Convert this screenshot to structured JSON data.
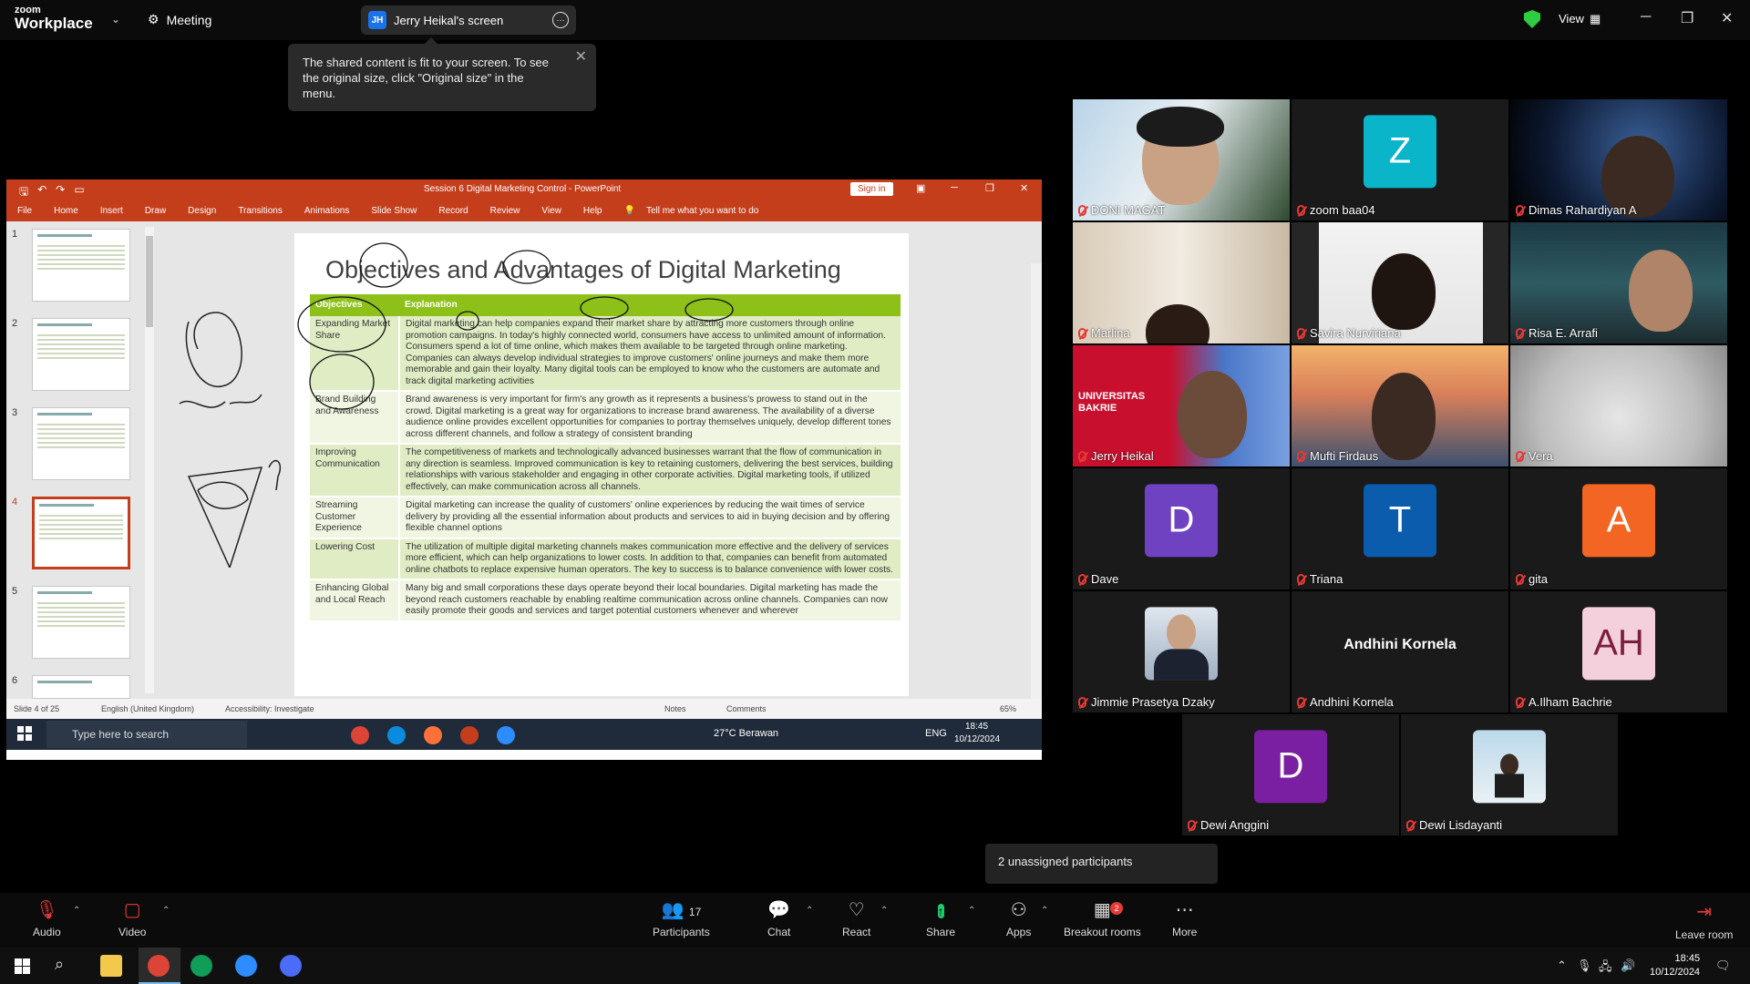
{
  "topbar": {
    "logo_line1": "zoom",
    "logo_line2": "Workplace",
    "meeting_label": "Meeting",
    "screen_badge": "JH",
    "screen_label": "Jerry Heikal's screen",
    "view_label": "View"
  },
  "tooltip": {
    "text": "The shared content is fit to your screen. To see the original size, click \"Original size\" in the menu."
  },
  "powerpoint": {
    "title": "Session 6 Digital Marketing Control  -  PowerPoint",
    "sign_in": "Sign in",
    "menu": [
      "File",
      "Home",
      "Insert",
      "Draw",
      "Design",
      "Transitions",
      "Animations",
      "Slide Show",
      "Record",
      "Review",
      "View",
      "Help"
    ],
    "tell_me": "Tell me what you want to do",
    "thumb_numbers": [
      "1",
      "2",
      "3",
      "4",
      "5",
      "6"
    ],
    "slide": {
      "title": "Objectives and Advantages of Digital Marketing",
      "col1": "Objectives",
      "col2": "Explanation",
      "rows": [
        {
          "objective": "Expanding Market Share",
          "explanation": "Digital marketing can help companies expand their market share by attracting more customers through online promotion campaigns. In today's highly connected world, consumers have access to unlimited amount of information. Consumers spend a lot of time online, which makes them available to be targeted through online marketing. Companies can always develop individual strategies to improve customers' online journeys and make them more memorable and gain their loyalty. Many digital tools can be employed to know who the customers are automate and track digital marketing activities"
        },
        {
          "objective": "Brand Building and Awareness",
          "explanation": "Brand awareness is very important for firm's any growth as it represents a business's prowess to stand out in the crowd. Digital marketing is a great way for organizations to increase brand awareness. The availability of a diverse audience online provides excellent opportunities for companies to portray themselves uniquely, develop different tones across different channels, and follow a strategy of consistent branding"
        },
        {
          "objective": "Improving Communication",
          "explanation": "The competitiveness of markets and technologically advanced businesses warrant that the flow of communication in any direction is seamless. Improved communication is key to retaining customers, delivering the best services, building relationships with various stakeholder and engaging in other corporate activities. Digital marketing tools, if utilized effectively, can make communication across all channels."
        },
        {
          "objective": "Streaming Customer Experience",
          "explanation": "Digital marketing can increase the quality of customers' online experiences by reducing the wait times of service delivery by providing all the essential information about products and services to aid in buying decision and by offering flexible channel options"
        },
        {
          "objective": "Lowering Cost",
          "explanation": "The utilization of multiple digital marketing channels makes communication more effective and the delivery of services more efficient, which can help organizations to lower costs. In addition to that, companies can benefit from automated online chatbots to replace expensive human operators. The key to success is to balance convenience with lower costs."
        },
        {
          "objective": "Enhancing Global and Local Reach",
          "explanation": "Many big and small corporations these days operate beyond their local boundaries. Digital marketing has made the beyond reach customers reachable by enabling realtime communication across online channels. Companies can now easily promote their goods and services and target potential customers whenever and wherever"
        }
      ]
    },
    "status": {
      "slide_of": "Slide 4 of 25",
      "language": "English (United Kingdom)",
      "accessibility": "Accessibility: Investigate",
      "notes": "Notes",
      "comments": "Comments",
      "zoom": "65%"
    },
    "inner_taskbar": {
      "search_placeholder": "Type here to search",
      "weather": "27°C  Berawan",
      "lang": "ENG",
      "time": "18:45",
      "date": "10/12/2024"
    }
  },
  "participants": [
    {
      "name": "DONI MAGAT"
    },
    {
      "name": "zoom baa04",
      "initial": "Z",
      "color": "#0bb5c9"
    },
    {
      "name": "Dimas Rahardiyan A"
    },
    {
      "name": "Marlina"
    },
    {
      "name": "Savira Nurviriana"
    },
    {
      "name": "Risa E. Arrafi"
    },
    {
      "name": "Jerry Heikal",
      "banner": "UNIVERSITAS BAKRIE"
    },
    {
      "name": "Mufti Firdaus"
    },
    {
      "name": "Vera"
    },
    {
      "name": "Dave",
      "initial": "D",
      "color": "#6f42c1"
    },
    {
      "name": "Triana",
      "initial": "T",
      "color": "#0b5cad"
    },
    {
      "name": "gita",
      "initial": "A",
      "color": "#f26522"
    },
    {
      "name": "Jimmie Prasetya Dzaky"
    },
    {
      "name": "Andhini Kornela"
    },
    {
      "name": "A.Ilham Bachrie",
      "initial": "AH",
      "color": "#f4cfdc"
    },
    {
      "name": "Dewi Anggini",
      "initial": "D",
      "color": "#7b1fa2"
    },
    {
      "name": "Dewi Lisdayanti"
    }
  ],
  "unassigned": "2 unassigned participants",
  "toolbar": {
    "audio": "Audio",
    "video": "Video",
    "participants": "Participants",
    "participants_count": "17",
    "chat": "Chat",
    "react": "React",
    "share": "Share",
    "apps": "Apps",
    "breakout": "Breakout rooms",
    "breakout_badge": "2",
    "more": "More",
    "leave": "Leave room"
  },
  "windows": {
    "time": "18:45",
    "date": "10/12/2024"
  }
}
